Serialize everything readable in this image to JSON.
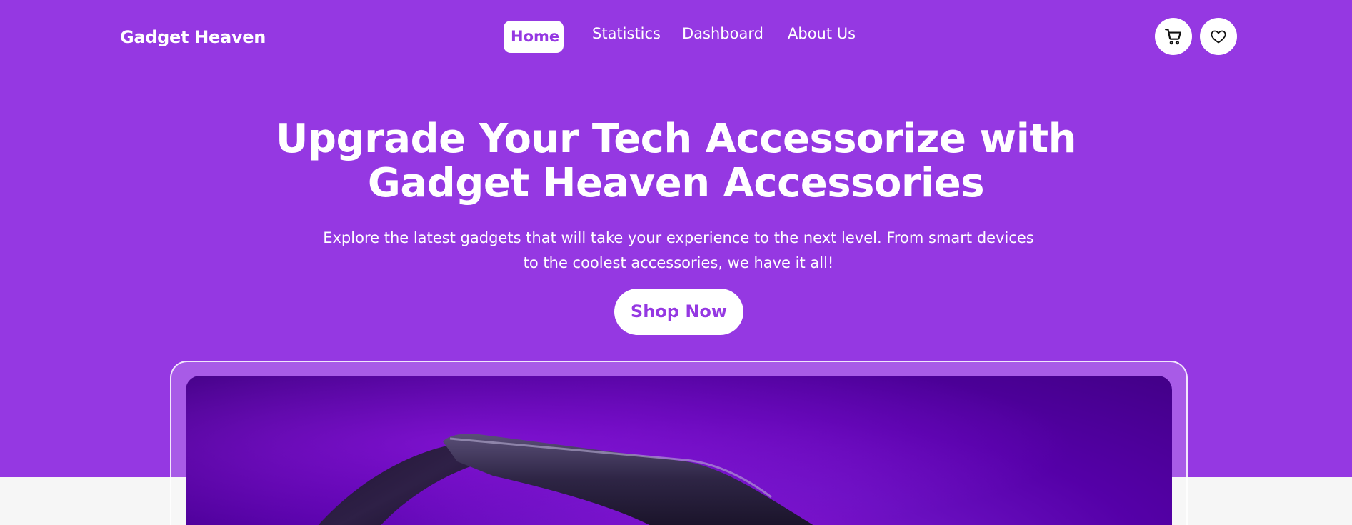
{
  "brand": {
    "name": "Gadget Heaven"
  },
  "nav": {
    "links": [
      {
        "label": "Home",
        "active": true
      },
      {
        "label": "Statistics",
        "active": false
      },
      {
        "label": "Dashboard",
        "active": false
      },
      {
        "label": "About Us",
        "active": false
      }
    ]
  },
  "actions": {
    "cart_icon": "cart-icon",
    "wishlist_icon": "heart-icon"
  },
  "hero": {
    "title": "Upgrade Your Tech Accessorize with Gadget Heaven Accessories",
    "subtitle": "Explore the latest gadgets that will take your experience to the next level. From smart devices to the coolest accessories, we have it all!",
    "cta_label": "Shop Now"
  },
  "banner": {
    "image_subject": "vr-headset"
  },
  "colors": {
    "primary": "#9538e2",
    "text_on_primary": "#ffffff",
    "page_bg": "#f6f6f6"
  }
}
